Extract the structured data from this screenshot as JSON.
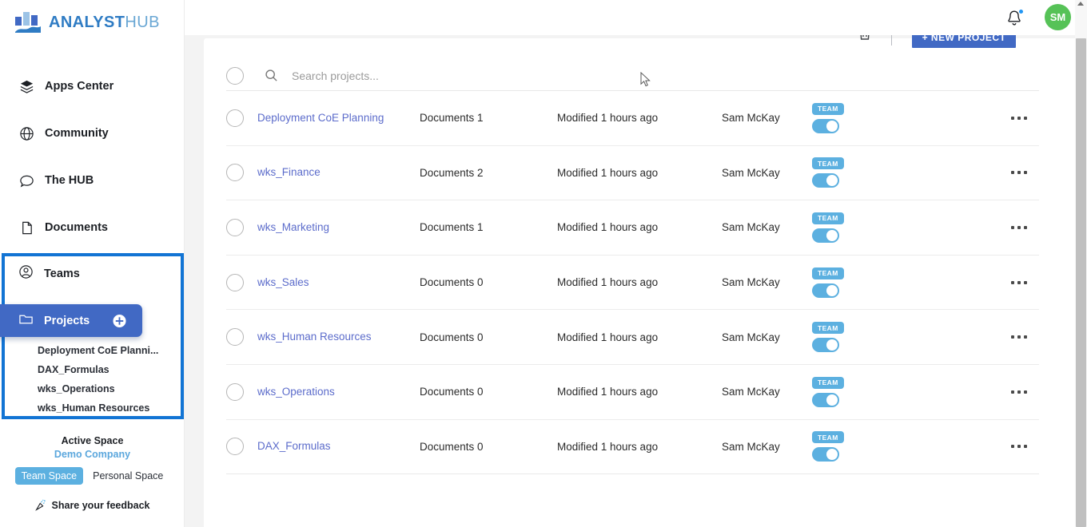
{
  "brand": {
    "name_bold": "ANALYST",
    "name_light": "HUB",
    "logo_icon": "bar-chart-wave-logo",
    "primary_color": "#4169c4",
    "accent_color": "#5cb0e0",
    "link_color": "#5c6ccb"
  },
  "sidebar": {
    "items": [
      {
        "label": "Apps Center",
        "icon": "layers-icon"
      },
      {
        "label": "Community",
        "icon": "globe-icon"
      },
      {
        "label": "The HUB",
        "icon": "chat-bubble-icon"
      },
      {
        "label": "Documents",
        "icon": "document-icon"
      }
    ],
    "teams": {
      "label": "Teams",
      "icon": "user-circle-icon"
    },
    "projects": {
      "label": "Projects",
      "icon": "folder-icon",
      "add_icon": "plus-circle-icon"
    },
    "project_list": [
      "Deployment CoE Planni...",
      "DAX_Formulas",
      "wks_Operations",
      "wks_Human Resources"
    ],
    "space": {
      "title": "Active Space",
      "company": "Demo Company",
      "tabs": [
        {
          "label": "Team Space",
          "active": true
        },
        {
          "label": "Personal Space",
          "active": false
        }
      ]
    },
    "feedback": {
      "label": "Share your feedback",
      "icon": "party-popper-icon"
    }
  },
  "header": {
    "bell_icon": "notification-bell-icon",
    "has_notification": true,
    "avatar_initials": "SM"
  },
  "toolbar": {
    "delete_icon": "trash-icon",
    "new_project_label": "+ NEW PROJECT"
  },
  "search": {
    "placeholder": "Search projects...",
    "value": "",
    "icon": "search-icon"
  },
  "table": {
    "rows": [
      {
        "name": "Deployment CoE Planning",
        "documents": "Documents 1",
        "modified": "Modified 1 hours ago",
        "owner": "Sam McKay",
        "badge": "TEAM",
        "toggle_on": true
      },
      {
        "name": "wks_Finance",
        "documents": "Documents 2",
        "modified": "Modified 1 hours ago",
        "owner": "Sam McKay",
        "badge": "TEAM",
        "toggle_on": true
      },
      {
        "name": "wks_Marketing",
        "documents": "Documents 1",
        "modified": "Modified 1 hours ago",
        "owner": "Sam McKay",
        "badge": "TEAM",
        "toggle_on": true
      },
      {
        "name": "wks_Sales",
        "documents": "Documents 0",
        "modified": "Modified 1 hours ago",
        "owner": "Sam McKay",
        "badge": "TEAM",
        "toggle_on": true
      },
      {
        "name": "wks_Human Resources",
        "documents": "Documents 0",
        "modified": "Modified 1 hours ago",
        "owner": "Sam McKay",
        "badge": "TEAM",
        "toggle_on": true
      },
      {
        "name": "wks_Operations",
        "documents": "Documents 0",
        "modified": "Modified 1 hours ago",
        "owner": "Sam McKay",
        "badge": "TEAM",
        "toggle_on": true
      },
      {
        "name": "DAX_Formulas",
        "documents": "Documents 0",
        "modified": "Modified 1 hours ago",
        "owner": "Sam McKay",
        "badge": "TEAM",
        "toggle_on": true
      }
    ]
  },
  "annotation": {
    "highlight_color": "#1274d4"
  }
}
